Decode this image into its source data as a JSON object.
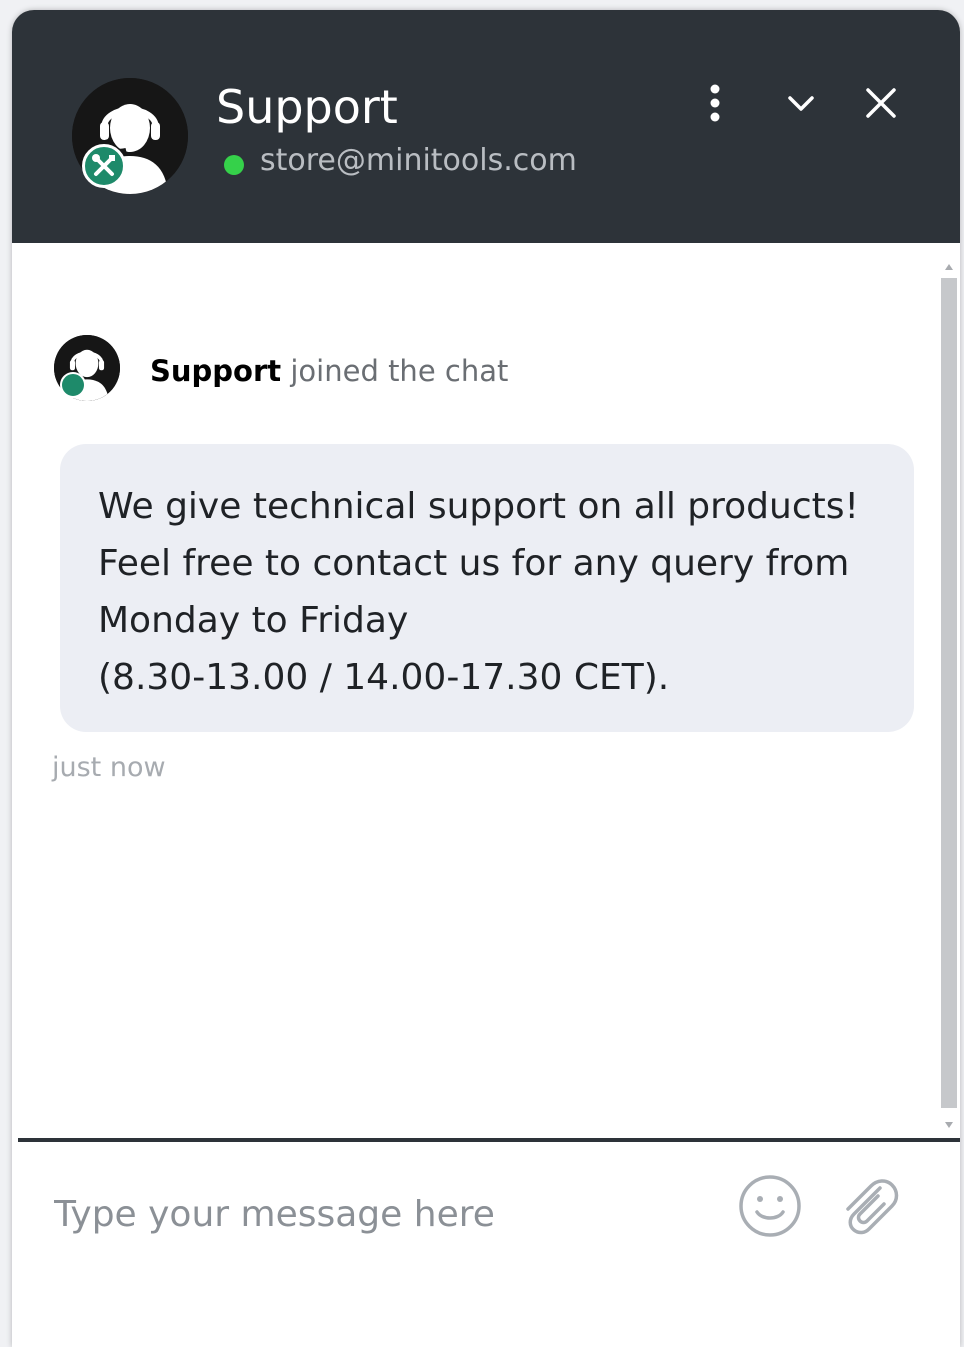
{
  "header": {
    "title": "Support",
    "email": "store@minitools.com",
    "status": "online",
    "status_color": "#35d14a",
    "background_color": "#2d3339",
    "buttons": {
      "menu_icon": "more-vertical-icon",
      "minimize_icon": "chevron-down-icon",
      "close_icon": "close-icon"
    }
  },
  "conversation": {
    "join_event": {
      "name": "Support",
      "text": "joined the chat"
    },
    "message": {
      "lines": [
        "We give technical support on all products!",
        "Feel free to contact us for any query from",
        "Monday to Friday",
        "(8.30-13.00 / 14.00-17.30 CET)."
      ],
      "timestamp": "just now"
    }
  },
  "composer": {
    "placeholder": "Type your message here",
    "value": "",
    "emoji_icon": "emoji-smile-icon",
    "attach_icon": "paperclip-icon"
  }
}
